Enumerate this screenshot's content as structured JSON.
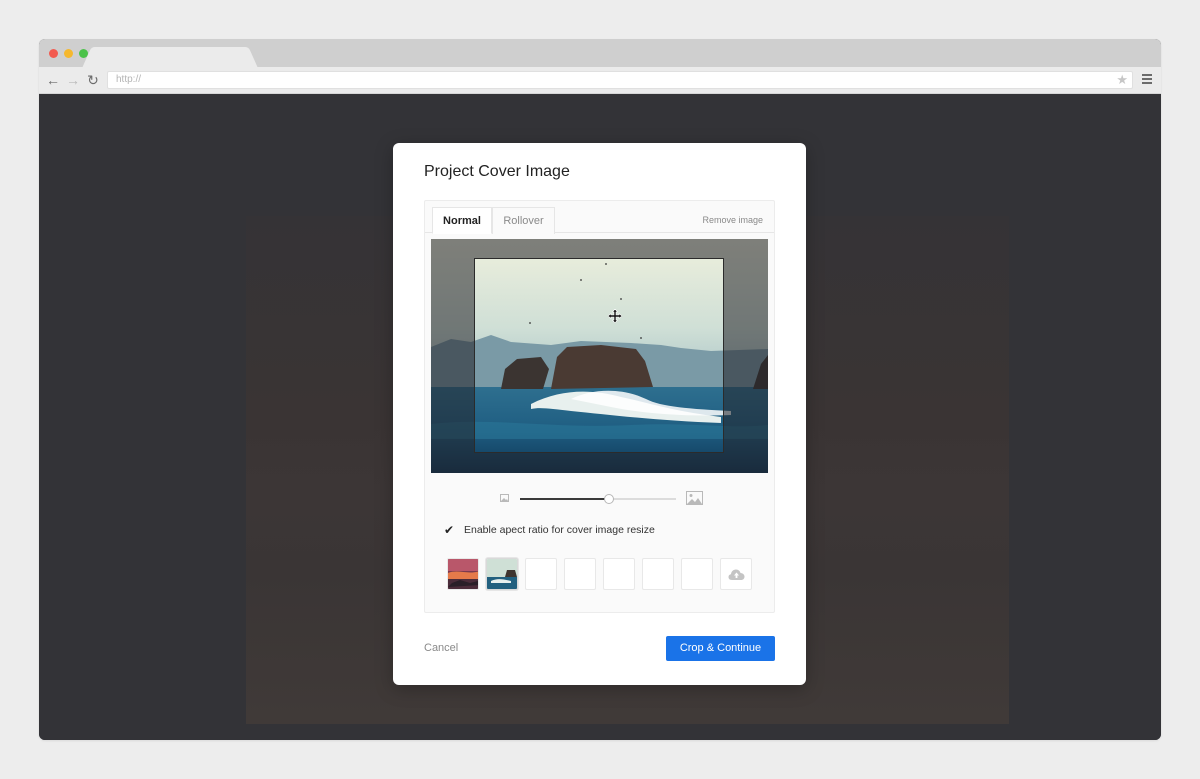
{
  "browser": {
    "address": "http://",
    "icons": [
      "back-arrow-icon",
      "forward-arrow-icon",
      "reload-icon",
      "star-icon",
      "hamburger-menu-icon"
    ]
  },
  "modal": {
    "title": "Project Cover Image",
    "tabs": [
      {
        "label": "Normal",
        "active": true
      },
      {
        "label": "Rollover",
        "active": false
      }
    ],
    "remove_label": "Remove image",
    "zoom_level": 0.57,
    "aspect": {
      "checked": true,
      "label": "Enable apect ratio for cover image resize"
    },
    "thumbnails": [
      {
        "type": "image",
        "description": "sunset"
      },
      {
        "type": "image",
        "description": "sea",
        "selected": true
      },
      {
        "type": "empty"
      },
      {
        "type": "empty"
      },
      {
        "type": "empty"
      },
      {
        "type": "empty"
      },
      {
        "type": "empty"
      },
      {
        "type": "upload",
        "icon": "cloud-upload-icon"
      }
    ],
    "cancel_label": "Cancel",
    "primary_label": "Crop & Continue"
  },
  "colors": {
    "primary": "#1a73e8",
    "backdrop": "#333337"
  }
}
